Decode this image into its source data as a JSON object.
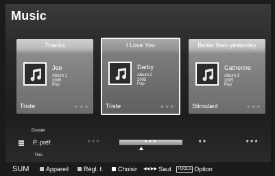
{
  "header": {
    "title": "Music"
  },
  "cards": [
    {
      "title": "Thanks",
      "artist": "Jee",
      "album": "Album 1",
      "year": "2005",
      "genre": "Pop",
      "mood": "Triste",
      "stars": "★★★",
      "selected": false
    },
    {
      "title": "I Love You",
      "artist": "Darby",
      "album": "Album 2",
      "year": "2005",
      "genre": "Pop",
      "mood": "Triste",
      "stars": "★★★",
      "selected": true
    },
    {
      "title": "Better than yesterday",
      "artist": "Catherine",
      "album": "Album 3",
      "year": "2005",
      "genre": "Pop",
      "mood": "Stimulant",
      "stars": "★★★",
      "selected": false
    }
  ],
  "sort_bar": {
    "above": "Dossier",
    "current": "P. préf.",
    "below": "Titre",
    "stars": [
      "★★★",
      "★★★",
      "★★",
      "★★★"
    ],
    "icons": [
      "menu-icon",
      "up-arrow-icon"
    ]
  },
  "footer": {
    "source": "SUM",
    "items": [
      {
        "label": "Appareil",
        "color": "#c8c8c8",
        "icon": "red-key-icon"
      },
      {
        "label": "Régl. f.",
        "color": "#c8c8c8",
        "icon": "green-key-icon"
      },
      {
        "label": "Choisir",
        "color": "#ffffff",
        "icon": "yellow-key-icon"
      },
      {
        "label": "Saut",
        "glyph": "◀◀ ▶▶",
        "icon": "skip-icon"
      },
      {
        "label": "Option",
        "tools": "TOOLS",
        "icon": "tools-icon"
      }
    ]
  },
  "colors": {
    "accent": "#ffffff",
    "background": "#1b1b1b"
  }
}
